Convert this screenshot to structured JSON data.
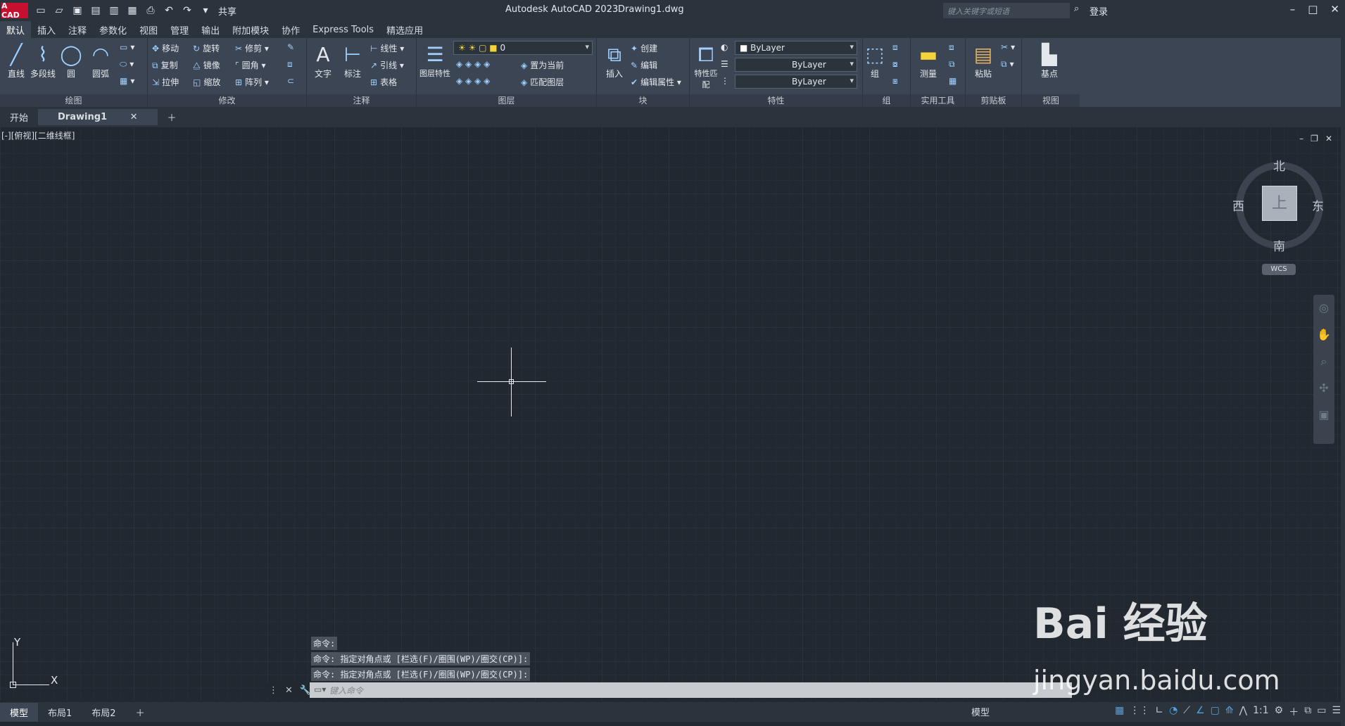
{
  "titlebar": {
    "logo": "A CAD",
    "app": "Autodesk AutoCAD 2023",
    "doc": "Drawing1.dwg",
    "share": "共享",
    "search_placeholder": "键入关键字或短语",
    "login": "登录"
  },
  "tabs": [
    "默认",
    "插入",
    "注释",
    "参数化",
    "视图",
    "管理",
    "输出",
    "附加模块",
    "协作",
    "Express Tools",
    "精选应用"
  ],
  "draw": {
    "line": "直线",
    "polyline": "多段线",
    "circle": "圆",
    "arc": "圆弧",
    "label": "绘图"
  },
  "modify": {
    "move": "移动",
    "rotate": "旋转",
    "trim": "修剪",
    "copy": "复制",
    "mirror": "镜像",
    "fillet": "圆角",
    "stretch": "拉伸",
    "scale": "缩放",
    "array": "阵列",
    "label": "修改"
  },
  "annotation": {
    "text": "文字",
    "dim": "标注",
    "linear": "线性",
    "leader": "引线",
    "table": "表格",
    "label": "注释"
  },
  "layers": {
    "props": "图层特性",
    "current_layer": "0",
    "set_current": "置为当前",
    "match": "匹配图层",
    "label": "图层"
  },
  "block": {
    "insert": "插入",
    "create": "创建",
    "edit": "编辑",
    "edit_attr": "编辑属性",
    "label": "块"
  },
  "properties": {
    "match": "特性匹配",
    "color": "ByLayer",
    "linetype": "ByLayer",
    "lineweight": "ByLayer",
    "label": "特性"
  },
  "groups": {
    "group": "组",
    "label": "组"
  },
  "utilities": {
    "measure": "测量",
    "label": "实用工具"
  },
  "clipboard": {
    "paste": "粘贴",
    "label": "剪贴板"
  },
  "view": {
    "base": "基点",
    "label": "视图"
  },
  "doctabs": {
    "start": "开始",
    "drawing": "Drawing1"
  },
  "viewport": {
    "label": "[-][俯视][二维线框]"
  },
  "viewcube": {
    "top": "上",
    "north": "北",
    "south": "南",
    "east": "东",
    "west": "西",
    "wcs": "WCS"
  },
  "ucs": {
    "x": "X",
    "y": "Y"
  },
  "command": {
    "history": [
      "命令:",
      "命令: 指定对角点或 [栏选(F)/圈围(WP)/圈交(CP)]:",
      "命令: 指定对角点或 [栏选(F)/圈围(WP)/圈交(CP)]:"
    ],
    "placeholder": "键入命令"
  },
  "watermark": {
    "line1": "Bai  经验",
    "line2": "jingyan.baidu.com"
  },
  "statusbar": {
    "layouts": [
      "模型",
      "布局1",
      "布局2"
    ],
    "model_btn": "模型",
    "scale": "1:1"
  }
}
